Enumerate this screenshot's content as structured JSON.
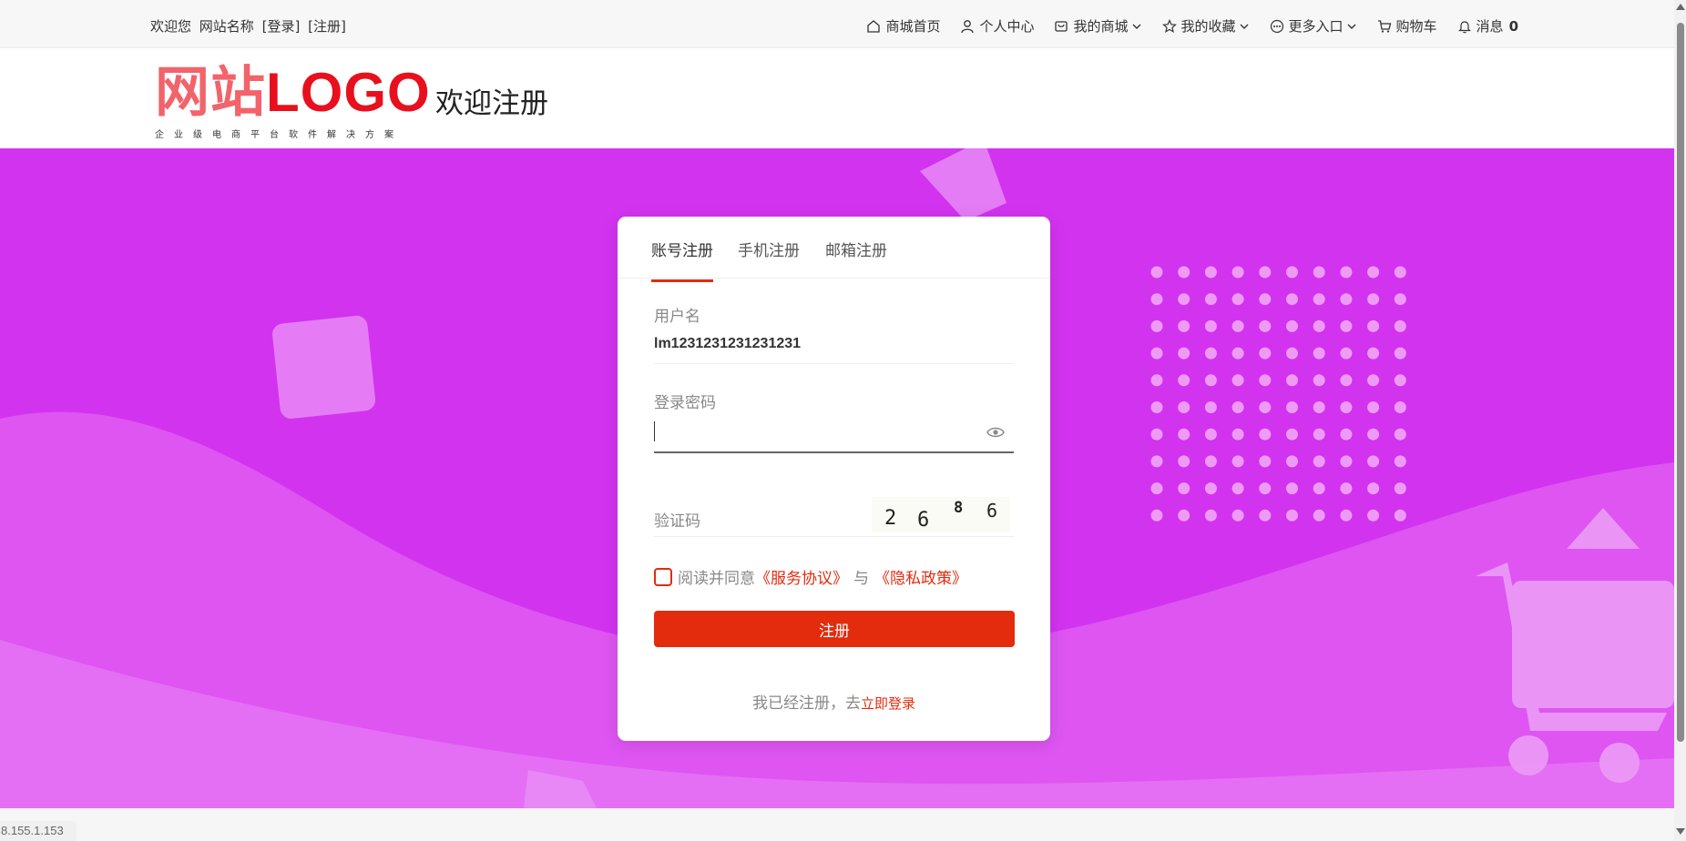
{
  "topbar": {
    "welcome": "欢迎您",
    "site_name": "网站名称",
    "login": "[登录]",
    "register": "[注册]",
    "nav": [
      {
        "label": "商城首页",
        "icon": "home-icon"
      },
      {
        "label": "个人中心",
        "icon": "user-icon"
      },
      {
        "label": "我的商城",
        "icon": "shop-icon"
      },
      {
        "label": "我的收藏",
        "icon": "star-icon"
      },
      {
        "label": "更多入口",
        "icon": "more-icon"
      },
      {
        "label": "购物车",
        "icon": "cart-icon"
      },
      {
        "label": "消息",
        "icon": "bell-icon",
        "count": "0"
      }
    ]
  },
  "header": {
    "logo_cn": "网站",
    "logo_en": "LOGO",
    "logo_sub": "企业级电商平台软件解决方案",
    "title": "欢迎注册"
  },
  "form": {
    "tabs": [
      "账号注册",
      "手机注册",
      "邮箱注册"
    ],
    "active_tab": 0,
    "username_label": "用户名",
    "username_value": "lm1231231231231231",
    "password_label": "登录密码",
    "password_value": "",
    "captcha_label": "验证码",
    "captcha_chars": [
      "2",
      "6",
      "8",
      "6"
    ],
    "agree_text": "阅读并同意",
    "agreement": "《服务协议》",
    "and": "与",
    "privacy": "《隐私政策》",
    "submit_label": "注册",
    "already_text": "我已经注册，去",
    "login_now": "立即登录"
  },
  "status_url": "8.155.1.153",
  "colors": {
    "accent": "#e32b0d",
    "banner": "#d233ef",
    "logo_cn": "#f2636a",
    "logo_en": "#e8101d"
  }
}
